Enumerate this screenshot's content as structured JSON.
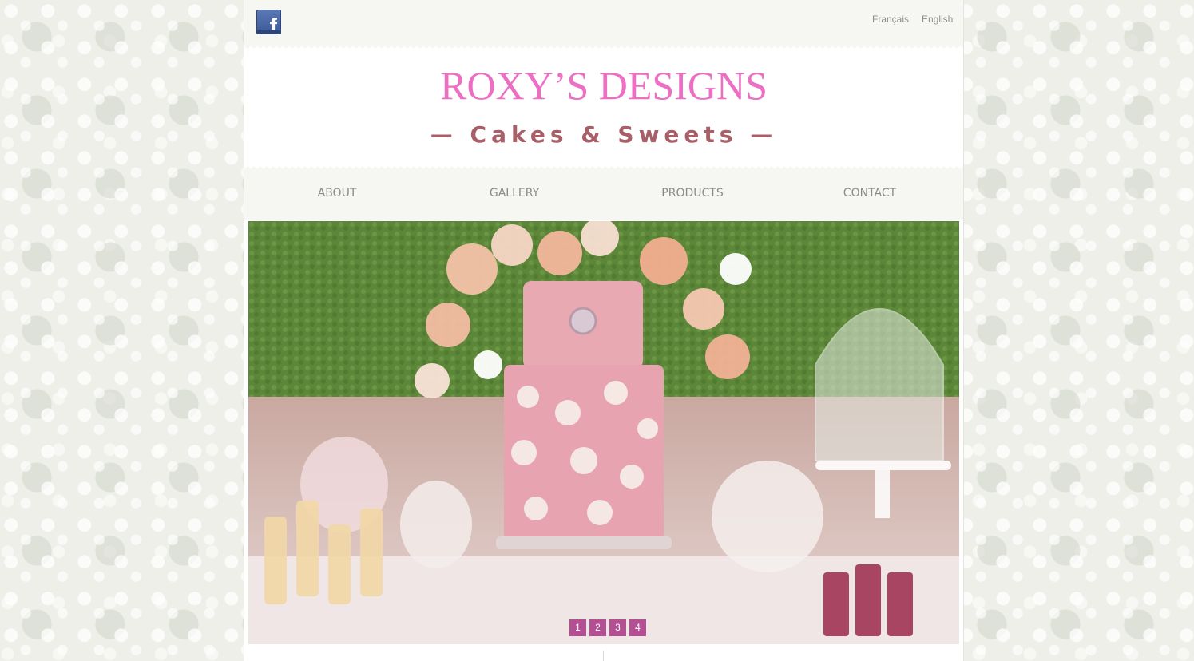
{
  "topbar": {
    "facebook_icon": "facebook-icon",
    "languages": [
      "Français",
      "English"
    ]
  },
  "header": {
    "brand": "ROXY’S DESIGNS",
    "tagline": "— Cakes & Sweets —"
  },
  "nav": {
    "items": [
      "ABOUT",
      "GALLERY",
      "PRODUCTS",
      "CONTACT"
    ]
  },
  "slider": {
    "pages": [
      "1",
      "2",
      "3",
      "4"
    ]
  },
  "colors": {
    "brand_pink": "#ec6fc4",
    "tagline_rose": "#a85f68",
    "slider_dot": "#b34f93",
    "nav_text": "#8a8a8a"
  }
}
